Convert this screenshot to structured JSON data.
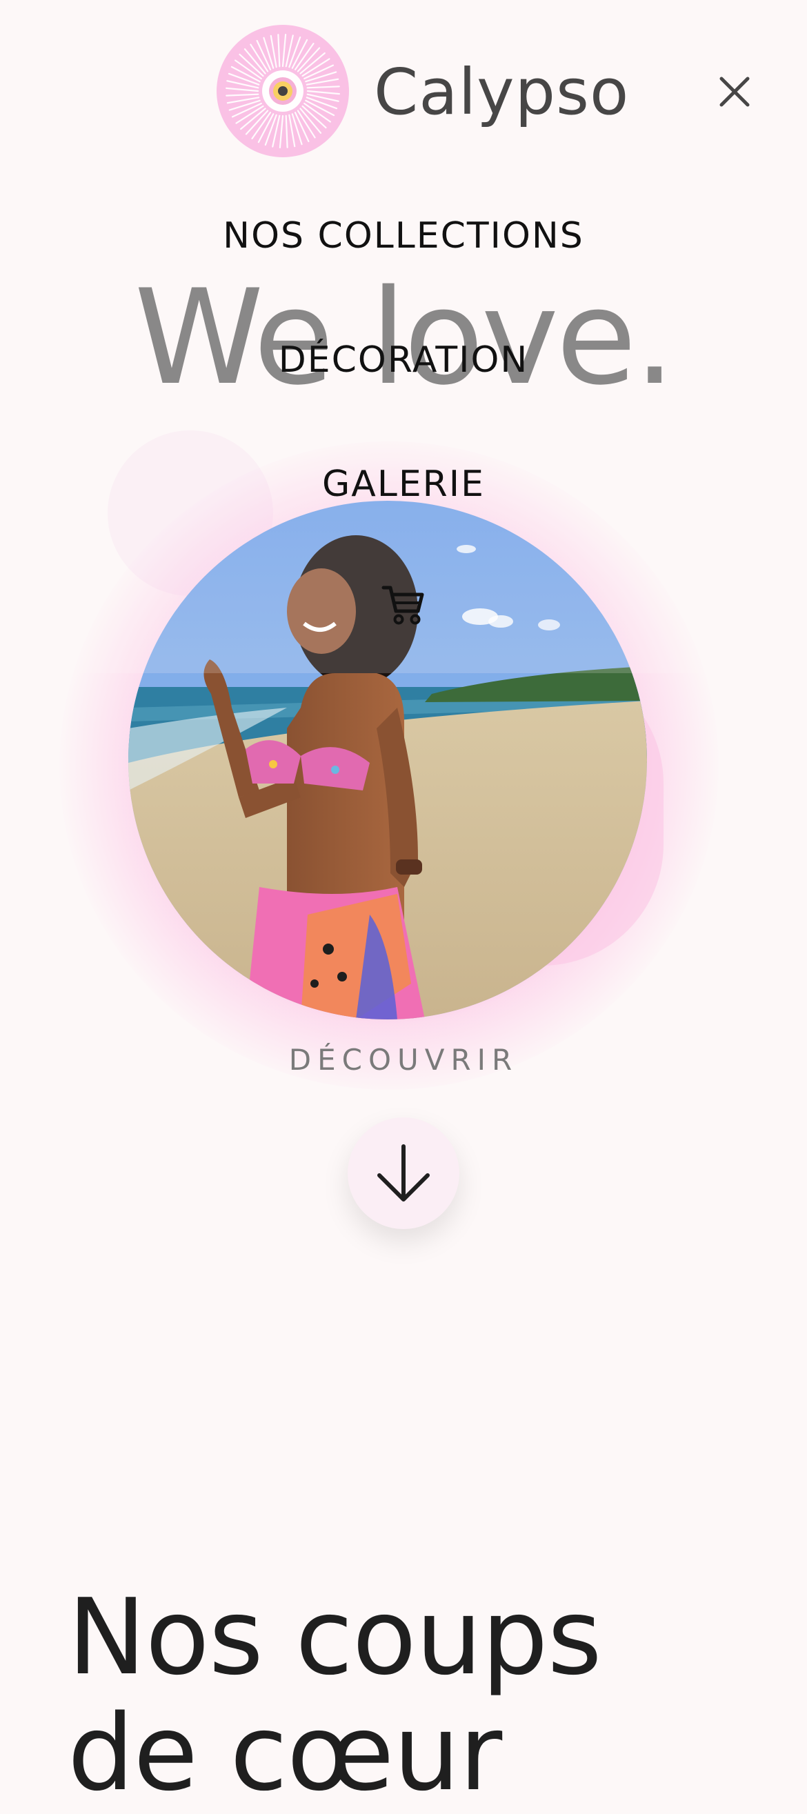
{
  "header": {
    "brand": "Calypso",
    "logo_icon": "sun-eye-logo-icon",
    "close_icon": "close-icon"
  },
  "menu": {
    "items": [
      {
        "label": "NOS COLLECTIONS"
      },
      {
        "label": "DÉCORATION"
      },
      {
        "label": "GALERIE"
      }
    ],
    "cart_icon": "cart-icon"
  },
  "hero": {
    "headline": "We love.",
    "photo_alt": "Woman laughing on a tropical beach wearing a pink patterned bikini and pareo",
    "cta_label": "DÉCOUVRIR",
    "scroll_icon": "arrow-down-icon"
  },
  "section": {
    "title": "Nos coups de cœur"
  },
  "colors": {
    "background": "#fdf8f8",
    "brand_pink": "#f9b5e1",
    "text_dark": "#1f1f1f",
    "hero_text": "#6f6f6f"
  }
}
